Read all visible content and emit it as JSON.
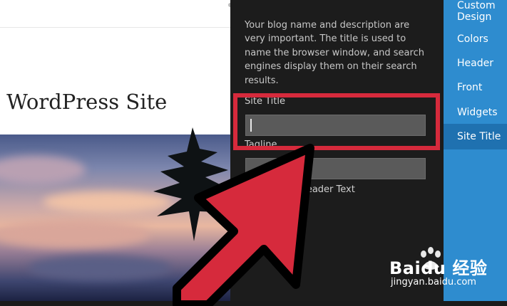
{
  "preview": {
    "heading": "r WordPress Site"
  },
  "panel": {
    "description": "Your blog name and description are very important. The title is used to name the browser window, and search engines display them on their search results.",
    "site_title_label": "Site Title",
    "site_title_value": "",
    "tagline_label": "Tagline",
    "tagline_value": "",
    "display_header_text_label": "Display Header Text"
  },
  "nav": {
    "items": [
      {
        "label": "Custom Design"
      },
      {
        "label": "Colors"
      },
      {
        "label": "Header"
      },
      {
        "label": "Front"
      },
      {
        "label": "Widgets"
      },
      {
        "label": "Site Title",
        "active": true
      }
    ]
  },
  "watermark": {
    "logo": "Baidu 经验",
    "sub": "jingyan.baidu.com"
  },
  "colors": {
    "highlight": "#d62a3c",
    "nav_bg": "#2e8ccf",
    "nav_active": "#1f71b0",
    "panel_bg": "#1c1c1c"
  }
}
